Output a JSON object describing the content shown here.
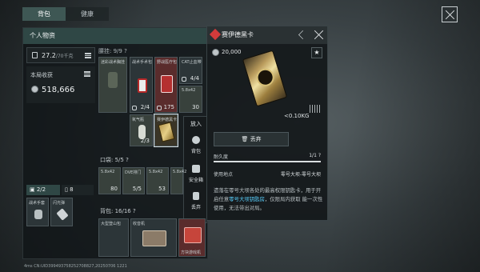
{
  "tabs": [
    "背包",
    "健康"
  ],
  "panel": {
    "title": "个人物资"
  },
  "weight": {
    "value": "27.2",
    "unit": "/70千克"
  },
  "income": {
    "label": "本局收获",
    "value": "518,666"
  },
  "belt": {
    "label": "腰挂: 9/9 ?"
  },
  "slots": [
    {
      "name": "迷彩战术胸挂",
      "count": ""
    },
    {
      "name": "战术手术包",
      "count": "2/4"
    },
    {
      "name": "野战医疗包",
      "count": "175"
    },
    {
      "name": "CAT止血带",
      "count": "4/4"
    },
    {
      "name": "5.8x42",
      "count": "30"
    },
    {
      "name": "氧气瓶",
      "count": "2/3"
    },
    {
      "name": "赛伊德黑卡",
      "count": ""
    }
  ],
  "context_menu": {
    "items": [
      "放入",
      "背包",
      "安全箱",
      "丢弃"
    ]
  },
  "pocket": {
    "label": "口袋: 5/5 ?",
    "items": [
      {
        "name": "5.8x42",
        "count": "80"
      },
      {
        "name": "DVE排门",
        "count": "5/5"
      },
      {
        "name": "5.8x42",
        "count": "53"
      },
      {
        "name": "5.8x42",
        "count": ""
      }
    ]
  },
  "quick": {
    "left": "2/2",
    "right": "8"
  },
  "pack": {
    "label": "背包: 16/16 ?",
    "items": [
      "大型登山包",
      "收音机",
      "",
      "",
      "方块游戏机"
    ]
  },
  "small_items": [
    "战术手套",
    "闪光弹"
  ],
  "detail": {
    "title": "赛伊德黑卡",
    "price": "20,000",
    "weight": "<0.10KG",
    "drop": "丢弃",
    "durability_label": "耐久度",
    "durability_value": "1/1",
    "durability_help": "?",
    "location_label": "使用地点",
    "location_value": "零号大坝-零号大坝",
    "desc_pre": "遗落在零号大坝各处的最高权限钥匙卡，用于开启任意",
    "desc_hl": "零号大坝钥匙房",
    "desc_post": "，仅限局内获取 能一次性使用，无法带出对局。"
  },
  "footer": "4ms   CN:UID399493758252708827,20250706 1221",
  "colors": {
    "accent": "#3e5754",
    "highlight": "#5ad1ff",
    "danger": "#d23b3b"
  }
}
